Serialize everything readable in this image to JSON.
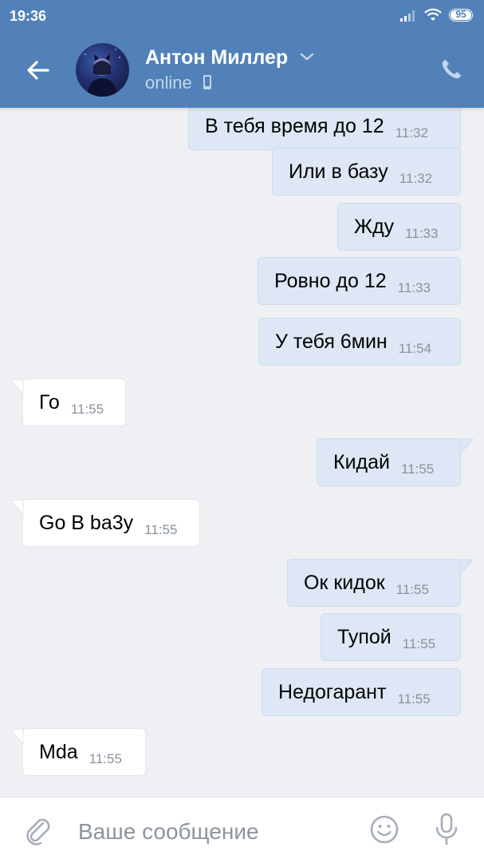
{
  "status_bar": {
    "time": "19:36",
    "battery": "95"
  },
  "header": {
    "contact_name": "Антон Миллер",
    "status": "online"
  },
  "messages": [
    {
      "side": "out",
      "text": "В тебя время до 12",
      "time": "11:32"
    },
    {
      "side": "out",
      "text": "Или в базу",
      "time": "11:32"
    },
    {
      "side": "out",
      "text": "Жду",
      "time": "11:33"
    },
    {
      "side": "out",
      "text": "Ровно до 12",
      "time": "11:33"
    },
    {
      "side": "out",
      "text": "У тебя 6мин",
      "time": "11:54"
    },
    {
      "side": "in",
      "text": "Го",
      "time": "11:55"
    },
    {
      "side": "out",
      "text": "Кидай",
      "time": "11:55"
    },
    {
      "side": "in",
      "text": "Go B ba3y",
      "time": "11:55"
    },
    {
      "side": "out",
      "text": "Ок кидок",
      "time": "11:55"
    },
    {
      "side": "out",
      "text": "Тупой",
      "time": "11:55"
    },
    {
      "side": "out",
      "text": "Недогарант",
      "time": "11:55"
    },
    {
      "side": "in",
      "text": "Mda",
      "time": "11:55"
    }
  ],
  "composer": {
    "placeholder": "Ваше сообщение"
  },
  "colors": {
    "header": "#5181b8",
    "outgoing": "#dde7f5",
    "incoming": "#ffffff",
    "background": "#eef0f4"
  }
}
